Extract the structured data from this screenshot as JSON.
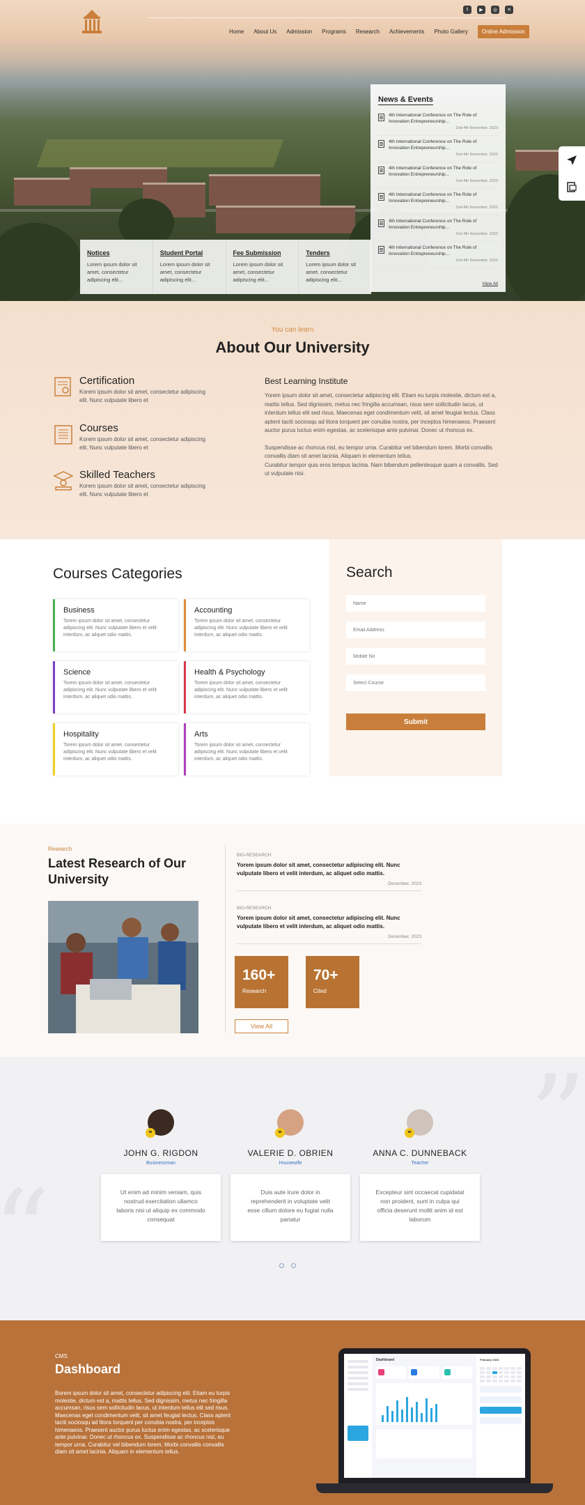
{
  "nav": {
    "items": [
      "Home",
      "About Us",
      "Admission",
      "Programs",
      "Research",
      "Achievements",
      "Photo Gallery"
    ],
    "cta": "Online Admission"
  },
  "news": {
    "title": "News & Events",
    "items": [
      {
        "title": "4th International Conference on The Role of Innovation Entrepreneurship...",
        "date": "2nd-4th November, 2023"
      },
      {
        "title": "4th International Conference on The Role of Innovation Entrepreneurship...",
        "date": "2nd-4th November, 2023"
      },
      {
        "title": "4th International Conference on The Role of Innovation Entrepreneurship...",
        "date": "2nd-4th November, 2023"
      },
      {
        "title": "4th International Conference on The Role of Innovation Entrepreneurship...",
        "date": "2nd-4th November, 2023"
      },
      {
        "title": "4th International Conference on The Role of Innovation Entrepreneurship...",
        "date": "2nd-4th November, 2023"
      },
      {
        "title": "4th International Conference on The Role of Innovation Entrepreneurship...",
        "date": "2nd-4th November, 2023"
      }
    ],
    "view_all": "View All"
  },
  "quick": [
    {
      "title": "Notices",
      "text": "Lorem ipsum dolor sit amet, consectetur adipiscing elit..."
    },
    {
      "title": "Student Portal",
      "text": "Lorem ipsum dolor sit amet, consectetur adipiscing elit..."
    },
    {
      "title": "Fee Submission",
      "text": "Lorem ipsum dolor sit amet, consectetur adipiscing elit..."
    },
    {
      "title": "Tenders",
      "text": "Lorem ipsum dolor sit amet, consectetur adipiscing elit..."
    }
  ],
  "about": {
    "kicker": "You can learn",
    "title": "About Our University",
    "features": [
      {
        "title": "Certification",
        "text": "Korem ipsum dolor sit amet, consectetur adipiscing elit. Nunc vulputate libero et"
      },
      {
        "title": "Courses",
        "text": "Korem ipsum dolor sit amet, consectetur adipiscing elit. Nunc vulputate libero et"
      },
      {
        "title": "Skilled Teachers",
        "text": "Korem ipsum dolor sit amet, consectetur adipiscing elit. Nunc vulputate libero et"
      }
    ],
    "right_title": "Best Learning Institute",
    "p1": "Yorem ipsum dolor sit amet, consectetur adipiscing elit. Etiam eu turpis molestie, dictum est a, mattis tellus. Sed dignissim, metus nec fringilla accumsan, risus sem sollicitudin lacus, ut interdum tellus elit sed risus. Maecenas eget condimentum velit, sit amet feugiat lectus. Class aptent taciti sociosqu ad litora torquent per conubia nostra, per inceptos himenaeos. Praesent auctor purus luctus enim egestas, ac scelerisque ante pulvinar. Donec ut rhoncus ex.",
    "p2": "Suspendisse ac rhoncus nisl, eu tempor urna. Curabitur vel bibendum lorem. Morbi convallis convallis diam sit amet lacinia. Aliquam in elementum tellus.",
    "p3": "Curabitur tempor quis eros tempus lacinia. Nam bibendum pellentesque quam a convallis. Sed ut vulputate nisi."
  },
  "courses": {
    "title": "Courses Categories",
    "items": [
      {
        "title": "Business",
        "text": "Torem ipsum dolor sit amet, consectetur adipiscing elit. Nunc vulputate libero et velit interdum, ac aliquet odio mattis.",
        "color": "#4caf50"
      },
      {
        "title": "Accounting",
        "text": "Torem ipsum dolor sit amet, consectetur adipiscing elit. Nunc vulputate libero et velit interdum, ac aliquet odio mattis.",
        "color": "#e58a3a"
      },
      {
        "title": "Science",
        "text": "Torem ipsum dolor sit amet, consectetur adipiscing elit. Nunc vulputate libero et velit interdum, ac aliquet odio mattis.",
        "color": "#7b3fc0"
      },
      {
        "title": "Health & Psychology",
        "text": "Torem ipsum dolor sit amet, consectetur adipiscing elit. Nunc vulputate libero et velit interdum, ac aliquet odio mattis.",
        "color": "#d8374a"
      },
      {
        "title": "Hospitality",
        "text": "Torem ipsum dolor sit amet, consectetur adipiscing elit. Nunc vulputate libero et velit interdum, ac aliquet odio mattis.",
        "color": "#f0d020"
      },
      {
        "title": "Arts",
        "text": "Torem ipsum dolor sit amet, consectetur adipiscing elit. Nunc vulputate libero et velit interdum, ac aliquet odio mattis.",
        "color": "#b03ec0"
      }
    ]
  },
  "search": {
    "title": "Search",
    "name_ph": "Name",
    "email_ph": "Email Address",
    "mobile_ph": "Mobile No",
    "course_ph": "Select Course",
    "submit": "Submit"
  },
  "research": {
    "kicker": "Research",
    "title": "Latest Research of Our University",
    "articles": [
      {
        "tag": "BIO-RESEARCH",
        "title": "Yorem ipsum dolor sit amet, consectetur adipiscing elit. Nunc vulputate libero et velit interdum, ac aliquet odio mattis.",
        "date": "December, 2023"
      },
      {
        "tag": "BIO-RESEARCH",
        "title": "Yorem ipsum dolor sit amet, consectetur adipiscing elit. Nunc vulputate libero et velit interdum, ac aliquet odio mattis.",
        "date": "December, 2023"
      }
    ],
    "stats": [
      {
        "value": "160+",
        "label": "Research"
      },
      {
        "value": "70+",
        "label": "Cited"
      }
    ],
    "view_all": "View All"
  },
  "testimonials": [
    {
      "name": "JOHN G. RIGDON",
      "role": "Businessman",
      "text": "Ut enim ad minim veniam, quis nostrud exercitation ullamco laboris nisi ut aliquip ex commodo consequat"
    },
    {
      "name": "VALERIE D. OBRIEN",
      "role": "Housewife",
      "text": "Duis aute irure dolor in reprehenderit in voluptate velit esse cillum dolore eu fugiat nulla pariatur"
    },
    {
      "name": "ANNA C. DUNNEBACK",
      "role": "Teacher",
      "text": "Excepteur sint occaecat cupidatat non proident, sunt in culpa qui officia deserunt mollit anim id est laborum"
    }
  ],
  "dashboard": {
    "kicker": "CMS",
    "title": "Dashboard",
    "text": "Borem ipsum dolor sit amet, consectetur adipiscing elit. Etiam eu turpis molestie, dictum est a, mattis tellus. Sed dignissim, metus nec fringilla accumsan, risus sem sollicitudin lacus, ut interdum tellus elit sed risus. Maecenas eget condimentum velit, sit amet feugiat lectus. Class aptent taciti sociosqu ad litora torquent per conubia nostra, per inceptos himenaeos. Praesent auctor purus luctus enim egestas, ac scelerisque ante pulvinar. Donec ut rhoncus ex. Suspendisse ac rhoncus nisl, eu tempor urna. Curabitur vel bibendum lorem. Morbi convallis convallis diam sit amet lacinia. Aliquam in elementum tellus.",
    "screen_title": "Dashboard",
    "screen_month": "February 2023"
  },
  "colors": {
    "accent": "#c97f3b",
    "brown": "#b8723a"
  }
}
